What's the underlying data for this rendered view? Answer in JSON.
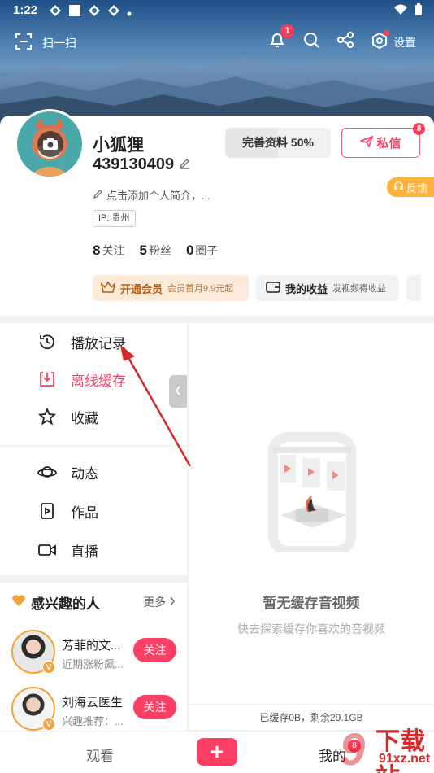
{
  "status_bar": {
    "time": "1:22"
  },
  "topbar": {
    "scan_label": "扫一扫",
    "notify_count": "1",
    "settings_label": "设置"
  },
  "profile": {
    "name": "小狐狸",
    "id": "439130409",
    "complete_label": "完善资料 50%",
    "message_label": "私信",
    "message_badge": "8",
    "intro": "点击添加个人简介，...",
    "feedback_label": "反馈",
    "ip": "IP: 贵州",
    "stats": [
      {
        "count": "8",
        "label": "关注"
      },
      {
        "count": "5",
        "label": "粉丝"
      },
      {
        "count": "0",
        "label": "圈子"
      }
    ],
    "vip": {
      "title": "开通会员",
      "subtitle": "会员首月9.9元起"
    },
    "earn": {
      "title": "我的收益",
      "subtitle": "发视频得收益"
    }
  },
  "menu": {
    "group1": [
      {
        "label": "播放记录",
        "icon": "history-icon"
      },
      {
        "label": "离线缓存",
        "icon": "download-icon"
      },
      {
        "label": "收藏",
        "icon": "star-icon"
      }
    ],
    "group2": [
      {
        "label": "动态",
        "icon": "planet-icon"
      },
      {
        "label": "作品",
        "icon": "works-icon"
      },
      {
        "label": "直播",
        "icon": "camera-icon"
      }
    ]
  },
  "panel": {
    "empty_title": "暂无缓存音视频",
    "empty_sub": "快去探索缓存你喜欢的音视频",
    "storage": "已缓存0B，剩余29.1GB"
  },
  "interests": {
    "title": "感兴趣的人",
    "more": "更多",
    "people": [
      {
        "name": "芳菲的文...",
        "desc": "近期涨粉飙...",
        "follow": "关注"
      },
      {
        "name": "刘海云医生",
        "desc": "兴趣推荐：...",
        "follow": "关注"
      }
    ]
  },
  "bottom_nav": {
    "watch": "观看",
    "plus": "+",
    "mine": "我的",
    "mine_badge": "8"
  },
  "watermark": {
    "digit": "9",
    "title": "下载站",
    "url": "91xz.net"
  },
  "colors": {
    "accent": "#fc3f65",
    "vip": "#b0621b",
    "feedback": "#ffb13b"
  }
}
